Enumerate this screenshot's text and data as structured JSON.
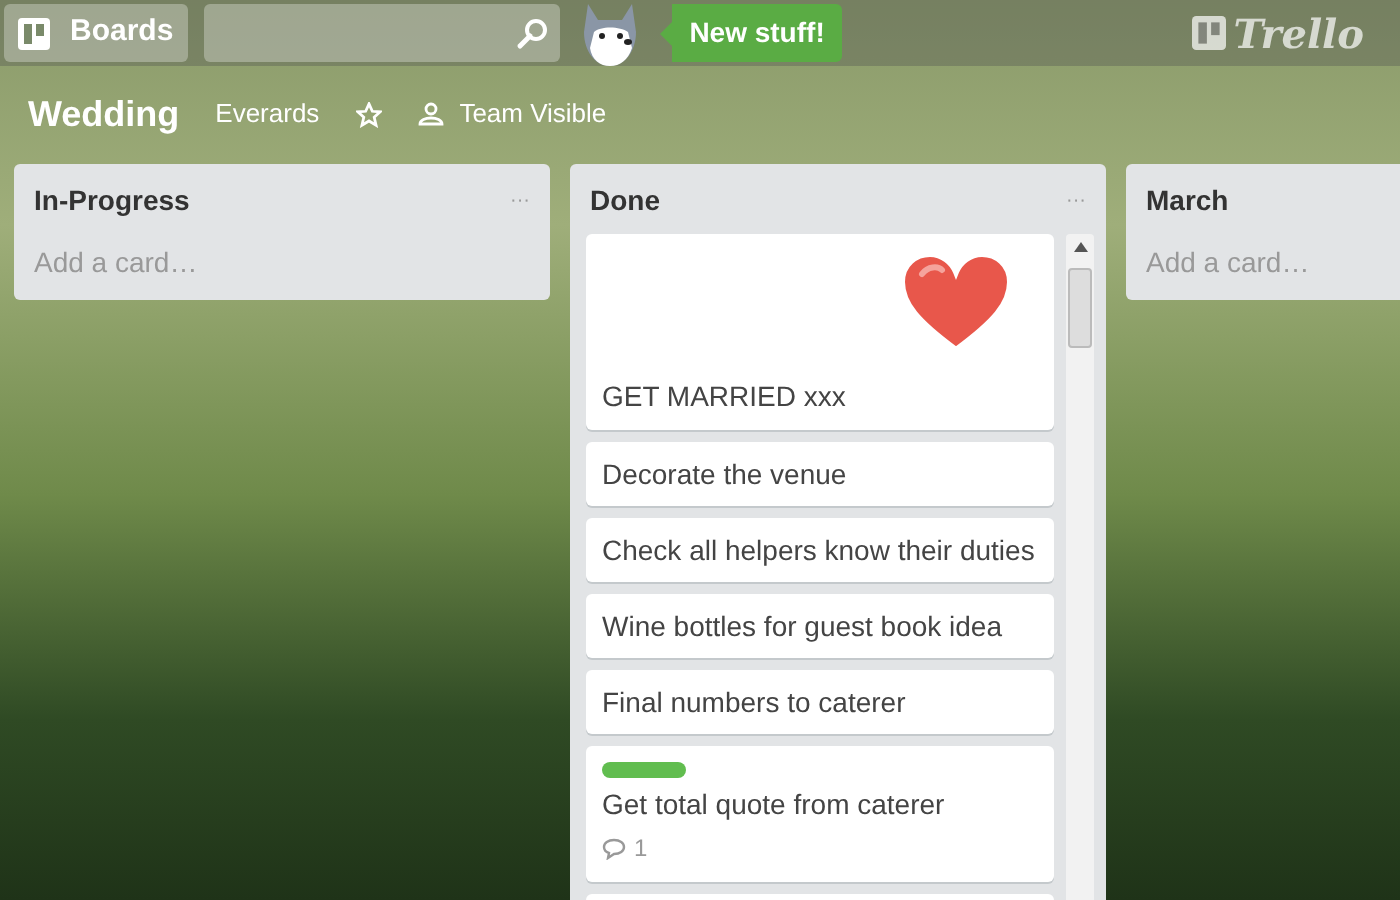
{
  "header": {
    "boards_button": "Boards",
    "promo": "New stuff!",
    "logo": "Trello"
  },
  "board": {
    "title": "Wedding",
    "team": "Everards",
    "starred": false,
    "visibility": "Team Visible"
  },
  "lists": [
    {
      "title": "In-Progress",
      "menu": "···",
      "add_card": "Add a card…"
    },
    {
      "title": "Done",
      "menu": "···",
      "scrollable": true,
      "cards": [
        {
          "kind": "cover",
          "text": "GET MARRIED xxx"
        },
        {
          "kind": "text",
          "text": "Decorate the venue"
        },
        {
          "kind": "text",
          "text": "Check all helpers know their duties"
        },
        {
          "kind": "text",
          "text": "Wine bottles for guest book idea"
        },
        {
          "kind": "text",
          "text": "Final numbers to caterer"
        },
        {
          "kind": "labeled",
          "text": "Get total quote from caterer",
          "color": "#61bd4f",
          "comments": "1"
        },
        {
          "kind": "blank"
        }
      ]
    },
    {
      "title": "March",
      "add_card": "Add a card…"
    }
  ]
}
